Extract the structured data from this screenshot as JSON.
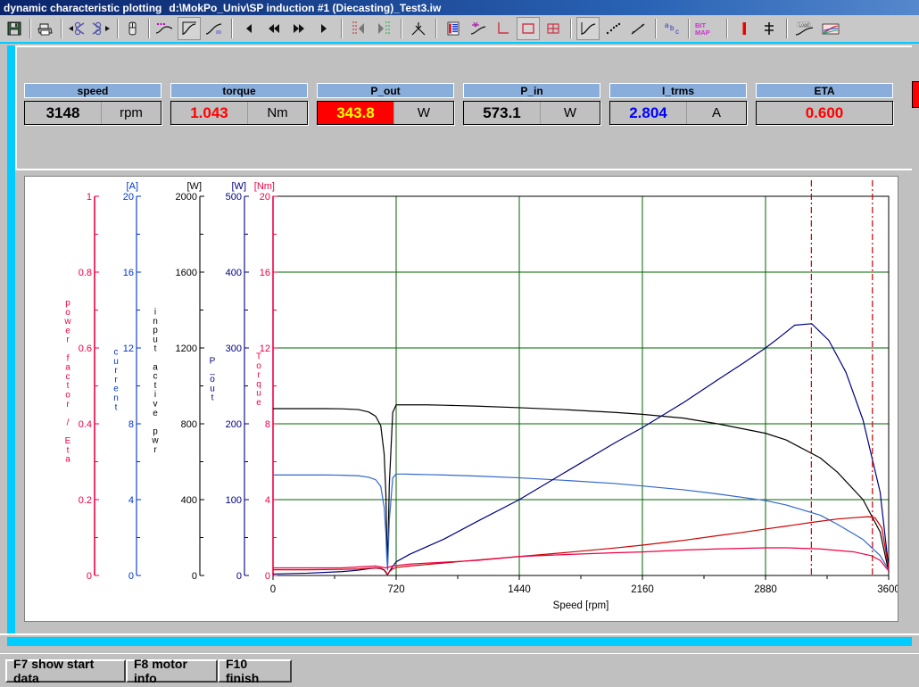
{
  "window": {
    "title_app": "dynamic characteristic plotting",
    "title_path": "d:\\MokPo_Univ\\SP induction #1 (Diecasting)_Test3.iw"
  },
  "toolbar": {
    "buttons": [
      {
        "name": "save-icon",
        "label": "save"
      },
      {
        "name": "print-icon",
        "label": "print"
      },
      {
        "name": "cut-left-icon",
        "label": "cut left"
      },
      {
        "name": "cut-right-icon",
        "label": "cut right"
      },
      {
        "name": "mouse-icon",
        "label": "mouse select"
      },
      {
        "name": "smooth-curve-icon",
        "label": "smooth"
      },
      {
        "name": "curve-view-icon",
        "label": "curve view"
      },
      {
        "name": "curve-fit-icon",
        "label": "curve fit"
      },
      {
        "name": "step-back-icon",
        "label": "step back"
      },
      {
        "name": "fast-back-icon",
        "label": "fast back"
      },
      {
        "name": "fast-forward-icon",
        "label": "fast forward"
      },
      {
        "name": "step-forward-icon",
        "label": "step forward"
      },
      {
        "name": "cursor-left-icon",
        "label": "cursor left"
      },
      {
        "name": "cursor-right-icon",
        "label": "cursor right"
      },
      {
        "name": "converge-icon",
        "label": "converge"
      },
      {
        "name": "legend-icon",
        "label": "legend"
      },
      {
        "name": "axis-icon",
        "label": "axis setup"
      },
      {
        "name": "corner-icon",
        "label": "corner"
      },
      {
        "name": "frame-icon",
        "label": "frame"
      },
      {
        "name": "grid-icon",
        "label": "grid"
      },
      {
        "name": "line-plot-icon",
        "label": "line plot"
      },
      {
        "name": "dot-plot-icon",
        "label": "dot plot"
      },
      {
        "name": "trend-plot-icon",
        "label": "trend plot"
      },
      {
        "name": "abc-icon",
        "label": "abc"
      },
      {
        "name": "bitmap-icon",
        "label": "BIT MAP"
      },
      {
        "name": "marker-icon",
        "label": "marker"
      },
      {
        "name": "tolerance-icon",
        "label": "tolerance"
      },
      {
        "name": "load-curve-icon",
        "label": "Load"
      },
      {
        "name": "overlay-icon",
        "label": "overlay"
      }
    ],
    "bitmap_label": "BIT MAP",
    "load_label": "Load"
  },
  "readout": {
    "fields": [
      {
        "name": "speed",
        "header": "speed",
        "value": "3148",
        "unit": "rpm",
        "value_color": "#000000",
        "bg": "#c0c0c0"
      },
      {
        "name": "torque",
        "header": "torque",
        "value": "1.043",
        "unit": "Nm",
        "value_color": "#ff0000",
        "bg": "#c0c0c0"
      },
      {
        "name": "p_out",
        "header": "P_out",
        "value": "343.8",
        "unit": "W",
        "value_color": "#ffff00",
        "bg": "#ff0000"
      },
      {
        "name": "p_in",
        "header": "P_in",
        "value": "573.1",
        "unit": "W",
        "value_color": "#000000",
        "bg": "#c0c0c0"
      },
      {
        "name": "i_trms",
        "header": "I_trms",
        "value": "2.804",
        "unit": "A",
        "value_color": "#0000ff",
        "bg": "#c0c0c0"
      },
      {
        "name": "eta",
        "header": "ETA",
        "value": "0.600",
        "unit": "",
        "value_color": "#ff0000",
        "bg": "#c0c0c0"
      }
    ]
  },
  "footer": {
    "buttons": [
      {
        "name": "f7-show-start-data",
        "label": "F7 show start data"
      },
      {
        "name": "f8-motor-info",
        "label": "F8 motor info"
      },
      {
        "name": "f10-finish",
        "label": "F10 finish"
      }
    ]
  },
  "chart_data": {
    "type": "line",
    "title": "",
    "xlabel": "Speed [rpm]",
    "xlim": [
      0,
      3600
    ],
    "xticks": [
      0,
      720,
      1440,
      2160,
      2880,
      3600
    ],
    "grid": true,
    "grid_color": "#006600",
    "legend_position": "none",
    "cursors": [
      {
        "name": "cursor-1",
        "x": 3148,
        "color": "#cc0000",
        "style": "dash-dot"
      },
      {
        "name": "cursor-2",
        "x": 3505,
        "color": "#cc0000",
        "style": "dash-dot"
      }
    ],
    "axes": [
      {
        "name": "power-factor-eta",
        "label": "power factor / Eta",
        "unit": "",
        "color": "#ee0044",
        "ticks": [
          0,
          0.2,
          0.4,
          0.6,
          0.8,
          1
        ],
        "tick_labels": [
          "0",
          "0.2",
          "0.4",
          "0.6",
          "0.8",
          "1"
        ],
        "ylim": [
          0,
          1
        ]
      },
      {
        "name": "current",
        "label": "current",
        "unit": "[A]",
        "color": "#0033cc",
        "ticks": [
          0,
          4,
          8,
          12,
          16,
          20
        ],
        "tick_labels": [
          "0",
          "4",
          "8",
          "12",
          "16",
          "20"
        ],
        "ylim": [
          0,
          20
        ]
      },
      {
        "name": "input-active-pwr",
        "label": "input active pwr",
        "unit": "[W]",
        "color": "#000000",
        "ticks": [
          0,
          400,
          800,
          1200,
          1600,
          2000
        ],
        "tick_labels": [
          "0",
          "400",
          "800",
          "1200",
          "1600",
          "2000"
        ],
        "ylim": [
          0,
          2000
        ]
      },
      {
        "name": "p-out",
        "label": "P_out",
        "unit": "[W]",
        "color": "#000080",
        "ticks": [
          0,
          100,
          200,
          300,
          400,
          500
        ],
        "tick_labels": [
          "0",
          "100",
          "200",
          "300",
          "400",
          "500"
        ],
        "ylim": [
          0,
          500
        ]
      },
      {
        "name": "torque",
        "label": "Torque",
        "unit": "[Nm]",
        "color": "#ee0044",
        "ticks": [
          0,
          4,
          8,
          12,
          16,
          20
        ],
        "tick_labels": [
          "0",
          "4",
          "8",
          "12",
          "16",
          "20"
        ],
        "ylim": [
          0,
          20
        ]
      }
    ],
    "series": [
      {
        "name": "input-active-pwr-curve",
        "axis": "input-active-pwr",
        "color": "#000000",
        "x": [
          0,
          100,
          200,
          300,
          400,
          500,
          560,
          600,
          630,
          650,
          660,
          665,
          670,
          680,
          700,
          720,
          760,
          800,
          900,
          1000,
          1200,
          1440,
          1700,
          2000,
          2160,
          2400,
          2600,
          2880,
          3000,
          3200,
          3300,
          3450,
          3550,
          3600
        ],
        "y": [
          880,
          880,
          880,
          880,
          879,
          875,
          862,
          840,
          790,
          640,
          430,
          200,
          60,
          480,
          860,
          900,
          900,
          900,
          900,
          898,
          893,
          885,
          875,
          860,
          850,
          830,
          800,
          750,
          715,
          620,
          545,
          400,
          230,
          20
        ]
      },
      {
        "name": "current-curve",
        "axis": "current",
        "color": "#3366cc",
        "x": [
          0,
          100,
          200,
          300,
          400,
          500,
          560,
          600,
          630,
          650,
          660,
          665,
          670,
          680,
          700,
          720,
          760,
          800,
          900,
          1000,
          1200,
          1440,
          1700,
          2000,
          2160,
          2400,
          2600,
          2880,
          3000,
          3200,
          3300,
          3450,
          3550,
          3600
        ],
        "y": [
          5.3,
          5.3,
          5.3,
          5.3,
          5.29,
          5.26,
          5.18,
          5.05,
          4.7,
          3.6,
          2.2,
          1.0,
          0.3,
          2.9,
          5.15,
          5.35,
          5.35,
          5.34,
          5.32,
          5.3,
          5.24,
          5.15,
          5.02,
          4.85,
          4.72,
          4.52,
          4.3,
          3.95,
          3.72,
          3.18,
          2.7,
          1.9,
          1.05,
          0.3
        ]
      },
      {
        "name": "p-out-curve",
        "axis": "p-out",
        "color": "#000080",
        "x": [
          0,
          200,
          400,
          500,
          560,
          600,
          630,
          650,
          660,
          665,
          670,
          680,
          700,
          720,
          800,
          900,
          1000,
          1200,
          1440,
          1700,
          2000,
          2160,
          2400,
          2600,
          2750,
          2880,
          2950,
          3050,
          3150,
          3250,
          3350,
          3450,
          3550,
          3600
        ],
        "y": [
          2,
          3,
          5,
          7,
          9,
          10,
          9,
          7,
          4,
          2,
          1,
          5,
          12,
          18,
          28,
          38,
          48,
          72,
          100,
          135,
          175,
          195,
          228,
          258,
          280,
          300,
          312,
          330,
          332,
          310,
          268,
          205,
          110,
          10
        ]
      },
      {
        "name": "torque-curve",
        "axis": "torque",
        "color": "#cc0000",
        "x": [
          0,
          200,
          400,
          500,
          560,
          600,
          630,
          650,
          660,
          665,
          670,
          680,
          700,
          720,
          800,
          900,
          1000,
          1200,
          1440,
          1700,
          2000,
          2160,
          2400,
          2600,
          2750,
          2880,
          3000,
          3150,
          3300,
          3400,
          3480,
          3520,
          3560,
          3600
        ],
        "y": [
          0.3,
          0.3,
          0.32,
          0.34,
          0.38,
          0.4,
          0.38,
          0.3,
          0.2,
          0.1,
          0.05,
          0.2,
          0.35,
          0.42,
          0.5,
          0.58,
          0.66,
          0.82,
          1.0,
          1.2,
          1.45,
          1.6,
          1.85,
          2.1,
          2.28,
          2.45,
          2.6,
          2.8,
          2.98,
          3.05,
          3.1,
          3.05,
          2.5,
          0.4
        ]
      },
      {
        "name": "power-factor-curve",
        "axis": "power-factor-eta",
        "color": "#ee0044",
        "x": [
          0,
          200,
          400,
          600,
          660,
          700,
          800,
          1000,
          1200,
          1440,
          1700,
          2000,
          2160,
          2400,
          2600,
          2880,
          3000,
          3200,
          3400,
          3500,
          3550,
          3600
        ],
        "y": [
          0.02,
          0.02,
          0.02,
          0.025,
          0.02,
          0.025,
          0.03,
          0.035,
          0.04,
          0.05,
          0.055,
          0.06,
          0.062,
          0.067,
          0.07,
          0.073,
          0.073,
          0.07,
          0.062,
          0.052,
          0.04,
          0.012
        ]
      }
    ]
  }
}
